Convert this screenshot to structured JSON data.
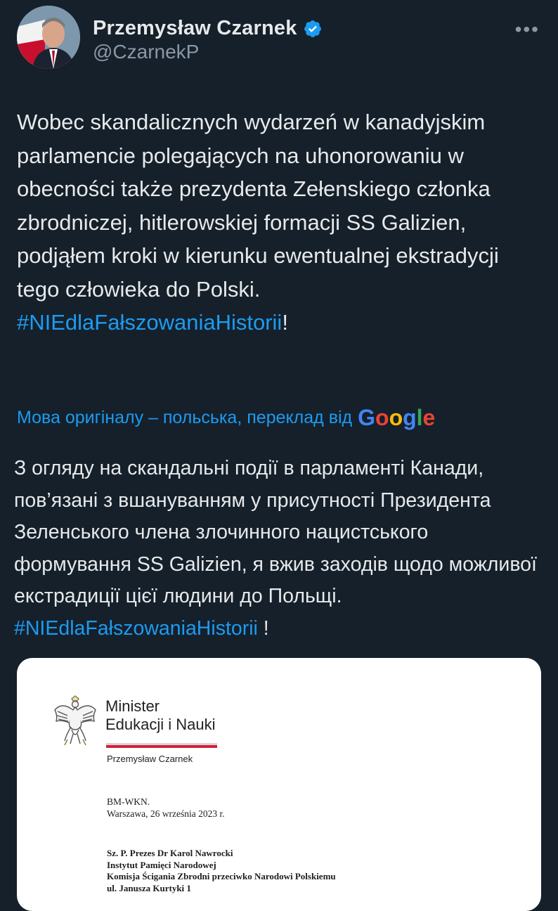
{
  "author": {
    "name": "Przemysław Czarnek",
    "handle": "@CzarnekP",
    "verified": true,
    "more_icon": "more-horizontal-icon"
  },
  "tweet": {
    "text": "Wobec skandalicznych wydarzeń w kanadyjskim parlamencie polegających na uhonorowaniu w obecności także prezydenta Zełenskiego członka zbrodniczej, hitlerowskiej formacji SS Galizien, podjąłem kroki w kierunku ewentualnej ekstradycji tego człowieka do Polski.",
    "hashtag": "#NIEdlaFałszowaniaHistorii",
    "trailing": "!"
  },
  "translation": {
    "note": "Мова оригіналу – польська, переклад від",
    "provider": "Google",
    "text": "З огляду на скандальні події в парламенті Канади, пов’язані з вшануванням у присутності Президента Зеленського члена злочинного нацистського формування SS Galizien, я вжив заходів щодо можливої екстрадиції цієї людини до Польщі.",
    "hashtag": "#NIEdlaFałszowaniaHistorii",
    "trailing": " !"
  },
  "document": {
    "ministry_line1": "Minister",
    "ministry_line2": "Edukacji i Nauki",
    "signer": "Przemysław Czarnek",
    "reference": "BM-WKN.",
    "place_date": "Warszawa,  26 września 2023 r.",
    "addressee_line1": "Sz. P. Prezes Dr Karol Nawrocki",
    "addressee_line2": "Instytut Pamięci Narodowej",
    "addressee_line3": "Komisja Ścigania Zbrodni przeciwko Narodowi Polskiemu",
    "addressee_line4": "ul. Janusza Kurtyki 1"
  },
  "colors": {
    "background": "#15202b",
    "link": "#1d9bf0",
    "verified": "#1d9bf0"
  }
}
